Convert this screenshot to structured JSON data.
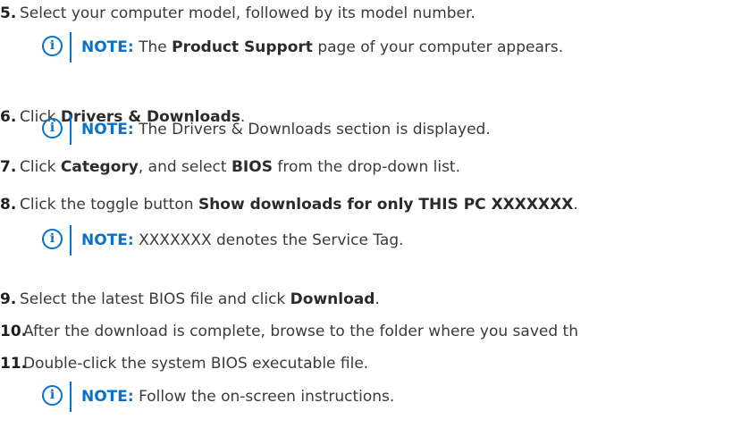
{
  "steps": [
    {
      "num": "5.",
      "pre": "Select your computer model, followed by its model number.",
      "bold": "",
      "post": ""
    },
    {
      "num": "6.",
      "pre": "Click ",
      "bold": "Drivers & Downloads",
      "post": "."
    },
    {
      "num": "7.",
      "pre": "Click ",
      "bold": "Category",
      "mid": ", and select ",
      "bold2": "BIOS",
      "post": " from the drop-down list."
    },
    {
      "num": "8.",
      "pre": "Click the toggle button ",
      "bold": "Show downloads for only THIS PC XXXXXXX",
      "post": "."
    },
    {
      "num": "9.",
      "pre": "Select the latest BIOS file and click ",
      "bold": "Download",
      "post": "."
    },
    {
      "num": "10.",
      "pre": "After the download is complete, browse to the folder where you saved th",
      "bold": "",
      "post": ""
    },
    {
      "num": "11.",
      "pre": "Double-click the system BIOS executable file.",
      "bold": "",
      "post": ""
    }
  ],
  "notes": [
    {
      "label": "NOTE:",
      "pre": " The ",
      "bold": "Product Support",
      "post": " page of your computer appears."
    },
    {
      "label": "NOTE:",
      "pre": " The Drivers & Downloads section is displayed.",
      "bold": "",
      "post": ""
    },
    {
      "label": "NOTE:",
      "pre": " XXXXXXX denotes the Service Tag.",
      "bold": "",
      "post": ""
    },
    {
      "label": "NOTE:",
      "pre": " Follow the on-screen instructions.",
      "bold": "",
      "post": ""
    }
  ],
  "icons": {
    "note": "info-icon",
    "note_glyph": "i"
  },
  "colors": {
    "accent": "#0672cb",
    "text": "#3a3a3a"
  }
}
